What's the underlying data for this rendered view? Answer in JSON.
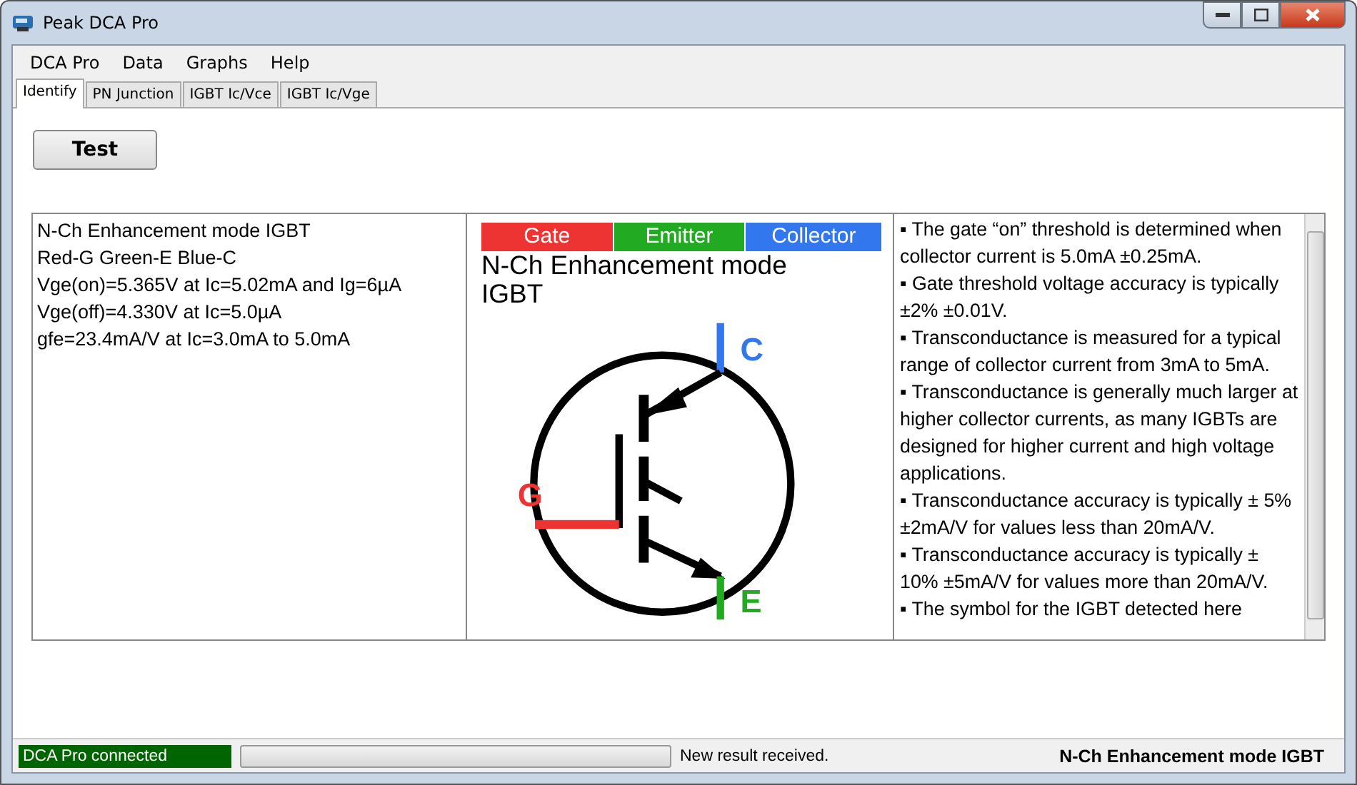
{
  "window": {
    "title": "Peak DCA Pro"
  },
  "menu": [
    "DCA Pro",
    "Data",
    "Graphs",
    "Help"
  ],
  "tabs": [
    {
      "label": "Identify",
      "selected": true
    },
    {
      "label": "PN Junction",
      "selected": false
    },
    {
      "label": "IGBT Ic/Vce",
      "selected": false
    },
    {
      "label": "IGBT Ic/Vge",
      "selected": false
    }
  ],
  "test_button": "Test",
  "results": [
    "N-Ch Enhancement mode IGBT",
    "Red-G Green-E Blue-C",
    "Vge(on)=5.365V at Ic=5.02mA and Ig=6µA",
    "Vge(off)=4.330V at Ic=5.0µA",
    "gfe=23.4mA/V at Ic=3.0mA to 5.0mA"
  ],
  "symbol": {
    "legend": [
      {
        "label": "Gate",
        "color": "#ee3333"
      },
      {
        "label": "Emitter",
        "color": "#22aa22"
      },
      {
        "label": "Collector",
        "color": "#3377ee"
      }
    ],
    "title": "N-Ch Enhancement mode IGBT",
    "terminals": {
      "gate": "G",
      "collector": "C",
      "emitter": "E"
    }
  },
  "notes": [
    "▪ The gate “on” threshold is determined when collector current is 5.0mA ±0.25mA.",
    "▪ Gate threshold voltage accuracy is typically ±2% ±0.01V.",
    "▪ Transconductance is measured for a typical range of collector current from 3mA to 5mA.",
    "▪ Transconductance is generally much larger at higher collector currents, as many IGBTs are designed for higher current and high voltage applications.",
    "▪ Transconductance accuracy is typically ± 5% ±2mA/V for values less than 20mA/V.",
    "▪ Transconductance accuracy is typically ± 10% ±5mA/V for values more than 20mA/V.",
    "▪ The symbol for the IGBT detected here"
  ],
  "status_bar": {
    "connection": "DCA Pro connected",
    "progress": {
      "level": 0
    },
    "message": "New result received.",
    "device": "N-Ch Enhancement mode IGBT"
  }
}
